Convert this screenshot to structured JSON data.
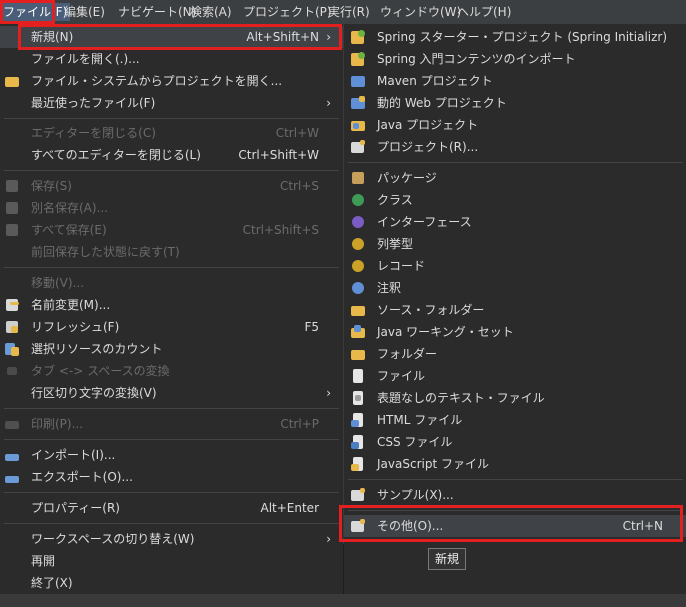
{
  "menubar": {
    "items": [
      "ファイル(F)",
      "編集(E)",
      "ナビゲート(N)",
      "検索(A)",
      "プロジェクト(P)",
      "実行(R)",
      "ウィンドウ(W)",
      "ヘルプ(H)"
    ]
  },
  "file_menu": {
    "new": {
      "label": "新規(N)",
      "shortcut": "Alt+Shift+N"
    },
    "open_file": {
      "label": "ファイルを開く(.)..."
    },
    "open_project": {
      "label": "ファイル・システムからプロジェクトを開く..."
    },
    "recent": {
      "label": "最近使ったファイル(F)"
    },
    "close_editor": {
      "label": "エディターを閉じる(C)",
      "shortcut": "Ctrl+W"
    },
    "close_all": {
      "label": "すべてのエディターを閉じる(L)",
      "shortcut": "Ctrl+Shift+W"
    },
    "save": {
      "label": "保存(S)",
      "shortcut": "Ctrl+S"
    },
    "save_as": {
      "label": "別名保存(A)..."
    },
    "save_all": {
      "label": "すべて保存(E)",
      "shortcut": "Ctrl+Shift+S"
    },
    "revert": {
      "label": "前回保存した状態に戻す(T)"
    },
    "move": {
      "label": "移動(V)..."
    },
    "rename": {
      "label": "名前変更(M)..."
    },
    "refresh": {
      "label": "リフレッシュ(F)",
      "shortcut": "F5"
    },
    "count": {
      "label": "選択リソースのカウント"
    },
    "tabs_spaces": {
      "label": "タブ <-> スペースの変換"
    },
    "line_delim": {
      "label": "行区切り文字の変換(V)"
    },
    "print": {
      "label": "印刷(P)...",
      "shortcut": "Ctrl+P"
    },
    "import": {
      "label": "インポート(I)..."
    },
    "export": {
      "label": "エクスポート(O)..."
    },
    "properties": {
      "label": "プロパティー(R)",
      "shortcut": "Alt+Enter"
    },
    "switch_ws": {
      "label": "ワークスペースの切り替え(W)"
    },
    "restart": {
      "label": "再開"
    },
    "exit": {
      "label": "終了(X)"
    }
  },
  "submenu": {
    "items": [
      "Spring スターター・プロジェクト (Spring Initializr)",
      "Spring 入門コンテンツのインポート",
      "Maven プロジェクト",
      "動的 Web プロジェクト",
      "Java プロジェクト",
      "プロジェクト(R)...",
      "パッケージ",
      "クラス",
      "インターフェース",
      "列挙型",
      "レコード",
      "注釈",
      "ソース・フォルダー",
      "Java ワーキング・セット",
      "フォルダー",
      "ファイル",
      "表題なしのテキスト・ファイル",
      "HTML ファイル",
      "CSS ファイル",
      "JavaScript ファイル",
      "サンプル(X)...",
      "その他(O)..."
    ],
    "other_shortcut": "Ctrl+N"
  },
  "tooltip": "新規"
}
